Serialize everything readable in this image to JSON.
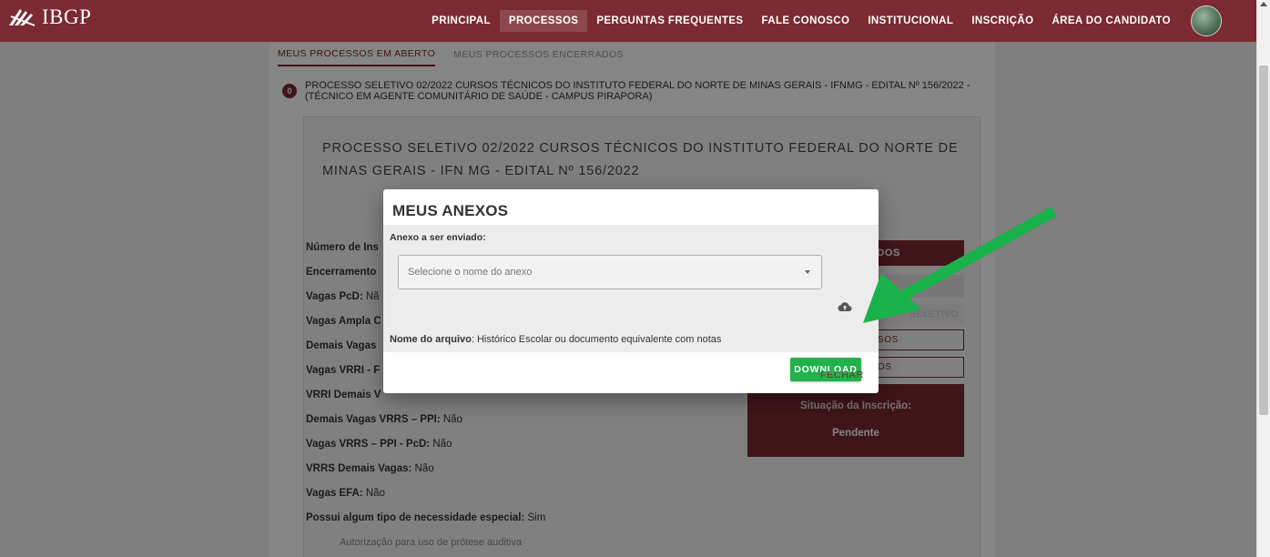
{
  "header": {
    "logo_text": "IBGP",
    "nav": [
      {
        "label": "PRINCIPAL",
        "active": false
      },
      {
        "label": "PROCESSOS",
        "active": true
      },
      {
        "label": "PERGUNTAS FREQUENTES",
        "active": false
      },
      {
        "label": "FALE CONOSCO",
        "active": false
      },
      {
        "label": "INSTITUCIONAL",
        "active": false
      },
      {
        "label": "INSCRIÇÃO",
        "active": false
      },
      {
        "label": "ÁREA DO CANDIDATO",
        "active": false
      }
    ]
  },
  "tabs": [
    {
      "label": "MEUS PROCESSOS EM ABERTO",
      "active": true
    },
    {
      "label": "MEUS PROCESSOS ENCERRADOS",
      "active": false
    }
  ],
  "process": {
    "badge": "0",
    "heading": "PROCESSO SELETIVO 02/2022 CURSOS TÉCNICOS DO INSTITUTO FEDERAL DO NORTE DE MINAS GERAIS - IFNMG - EDITAL Nº 156/2022 - (TÉCNICO EM AGENTE COMUNITÁRIO DE SAÚDE - CAMPUS PIRAPORA)",
    "card_title": "PROCESSO SELETIVO 02/2022 CURSOS TÉCNICOS DO INSTITUTO FEDERAL DO NORTE DE MINAS GERAIS - IFN MG - EDITAL Nº 156/2022",
    "fields": [
      {
        "label": "Número de Ins",
        "value": ""
      },
      {
        "label": "Encerramento",
        "value": ""
      },
      {
        "label": "Vagas PcD:",
        "value": "Nã"
      },
      {
        "label": "Vagas Ampla C",
        "value": ""
      },
      {
        "label": "Demais Vagas",
        "value": ""
      },
      {
        "label": "Vagas VRRI - F",
        "value": ""
      },
      {
        "label": "VRRI Demais V",
        "value": ""
      },
      {
        "label": "Demais Vagas VRRS – PPI:",
        "value": "Não"
      },
      {
        "label": "Vagas VRRS – PPI - PcD:",
        "value": "Não"
      },
      {
        "label": "VRRS Demais Vagas:",
        "value": "Não"
      },
      {
        "label": "Vagas EFA:",
        "value": "Não"
      },
      {
        "label": "Possui algum tipo de necessidade especial:",
        "value": "Sim"
      }
    ],
    "special_need_item": "Autorização para uso de prótese auditiva",
    "right_buttons": {
      "btn1": "ADOS",
      "btn3": "SELETIVO",
      "btn4": "SOS",
      "btn5": "OS"
    },
    "status_label": "Situação da Inscrição:",
    "status_value": "Pendente"
  },
  "dialog": {
    "title": "MEUS ANEXOS",
    "attachment_label": "Anexo a ser enviado:",
    "select_placeholder": "Selecione o nome do anexo",
    "filename_label": "Nome do arquivo",
    "filename_value": ": Histórico Escolar ou documento equivalente com notas",
    "download_label": "DOWNLOAD",
    "close_label": "FECHAR"
  },
  "colors": {
    "brand": "#7a2a30",
    "download": "#22b14c",
    "annotation_arrow": "#1ab24a"
  },
  "icons": [
    "logo-icon",
    "chevron-down-icon",
    "cloud-upload-icon",
    "scroll-up-icon"
  ]
}
